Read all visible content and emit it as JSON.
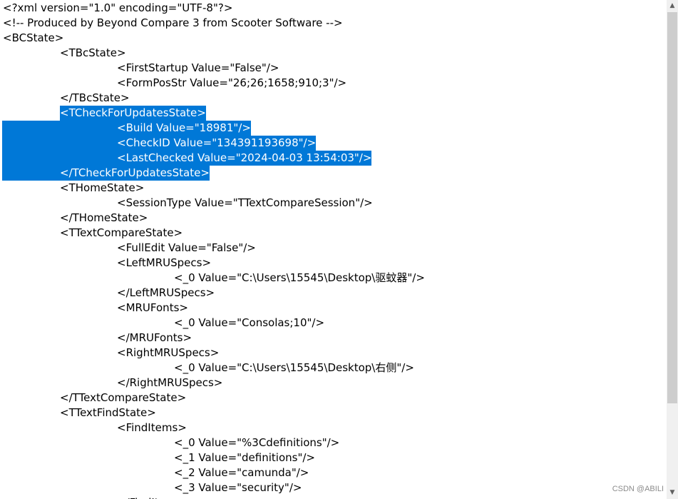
{
  "editor": {
    "lines": [
      {
        "indent": 0,
        "text": "<?xml version=\"1.0\" encoding=\"UTF-8\"?>"
      },
      {
        "indent": 0,
        "text": "<!-- Produced by Beyond Compare 3 from Scooter Software -->"
      },
      {
        "indent": 0,
        "text": "<BCState>"
      },
      {
        "indent": 1,
        "text": "<TBcState>"
      },
      {
        "indent": 2,
        "text": "<FirstStartup Value=\"False\"/>"
      },
      {
        "indent": 2,
        "text": "<FormPosStr Value=\"26;26;1658;910;3\"/>"
      },
      {
        "indent": 1,
        "text": "</TBcState>"
      },
      {
        "indent": 1,
        "text": "<TCheckForUpdatesState>",
        "selected": true
      },
      {
        "indent": 2,
        "text": "<Build Value=\"18981\"/>",
        "selected": true
      },
      {
        "indent": 2,
        "text": "<CheckID Value=\"134391193698\"/>",
        "selected": true
      },
      {
        "indent": 2,
        "text": "<LastChecked Value=\"2024-04-03 13:54:03\"/>",
        "selected": true
      },
      {
        "indent": 1,
        "text": "</TCheckForUpdatesState>",
        "selected": true
      },
      {
        "indent": 1,
        "text": "<THomeState>"
      },
      {
        "indent": 2,
        "text": "<SessionType Value=\"TTextCompareSession\"/>"
      },
      {
        "indent": 1,
        "text": "</THomeState>"
      },
      {
        "indent": 1,
        "text": "<TTextCompareState>"
      },
      {
        "indent": 2,
        "text": "<FullEdit Value=\"False\"/>"
      },
      {
        "indent": 2,
        "text": "<LeftMRUSpecs>"
      },
      {
        "indent": 3,
        "text": "<_0 Value=\"C:\\Users\\15545\\Desktop\\驱蚊器\"/>"
      },
      {
        "indent": 2,
        "text": "</LeftMRUSpecs>"
      },
      {
        "indent": 2,
        "text": "<MRUFonts>"
      },
      {
        "indent": 3,
        "text": "<_0 Value=\"Consolas;10\"/>"
      },
      {
        "indent": 2,
        "text": "</MRUFonts>"
      },
      {
        "indent": 2,
        "text": "<RightMRUSpecs>"
      },
      {
        "indent": 3,
        "text": "<_0 Value=\"C:\\Users\\15545\\Desktop\\右侧\"/>"
      },
      {
        "indent": 2,
        "text": "</RightMRUSpecs>"
      },
      {
        "indent": 1,
        "text": "</TTextCompareState>"
      },
      {
        "indent": 1,
        "text": "<TTextFindState>"
      },
      {
        "indent": 2,
        "text": "<FindItems>"
      },
      {
        "indent": 3,
        "text": "<_0 Value=\"%3Cdefinitions\"/>"
      },
      {
        "indent": 3,
        "text": "<_1 Value=\"definitions\"/>"
      },
      {
        "indent": 3,
        "text": "<_2 Value=\"camunda\"/>"
      },
      {
        "indent": 3,
        "text": "<_3 Value=\"security\"/>"
      },
      {
        "indent": 2,
        "text": "</FindItems>"
      }
    ]
  },
  "scrollbar": {
    "up_icon": "scroll-up-arrow-icon",
    "down_icon": "scroll-down-arrow-icon"
  },
  "watermark": "CSDN @ABILI",
  "colors": {
    "selection": "#0078d7",
    "selection_text": "#ffffff",
    "text": "#000000"
  }
}
